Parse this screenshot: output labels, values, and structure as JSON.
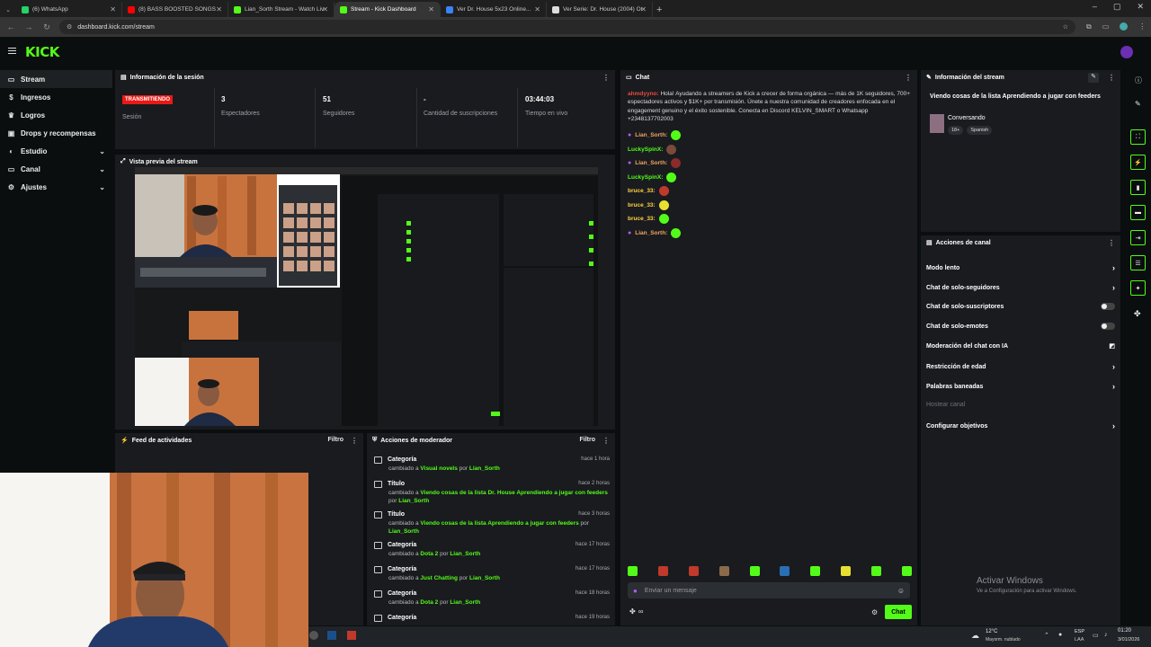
{
  "browser": {
    "tabs": [
      {
        "label": "(6) WhatsApp",
        "fav": "#25d366",
        "active": false
      },
      {
        "label": "(8) BASS BOOSTED SONGS 20...",
        "fav": "#ff0000",
        "active": false
      },
      {
        "label": "Lian_Sorth Stream - Watch Liv...",
        "fav": "#53fc18",
        "active": false
      },
      {
        "label": "Stream - Kick Dashboard",
        "fav": "#53fc18",
        "active": true
      },
      {
        "label": "Ver Dr. House 5x23 Online...",
        "fav": "#3b82f6",
        "active": false
      },
      {
        "label": "Ver Serie: Dr. House (2004) Onl...",
        "fav": "#dddddd",
        "active": false
      }
    ],
    "url": "dashboard.kick.com/stream"
  },
  "kick": {
    "logo": "KICK"
  },
  "sidebar": {
    "items": [
      {
        "label": "Stream",
        "icon": "broadcast-icon",
        "glyph": "▭",
        "active": true,
        "chev": false
      },
      {
        "label": "Ingresos",
        "icon": "money-icon",
        "glyph": "$",
        "active": false,
        "chev": false
      },
      {
        "label": "Logros",
        "icon": "trophy-icon",
        "glyph": "♛",
        "active": false,
        "chev": false
      },
      {
        "label": "Drops y recompensas",
        "icon": "gift-icon",
        "glyph": "▣",
        "active": false,
        "chev": false
      },
      {
        "label": "Estudio",
        "icon": "studio-icon",
        "glyph": "◐",
        "active": false,
        "chev": true
      },
      {
        "label": "Canal",
        "icon": "channel-icon",
        "glyph": "▭",
        "active": false,
        "chev": true
      },
      {
        "label": "Ajustes",
        "icon": "gear-icon",
        "glyph": "⚙",
        "active": false,
        "chev": true
      }
    ]
  },
  "session": {
    "title": "Información de la sesión",
    "badge": "TRANSMITIENDO",
    "session_label": "Sesión",
    "stats": [
      {
        "value": "3",
        "label": "Espectadores"
      },
      {
        "value": "51",
        "label": "Seguidores"
      },
      {
        "value": "-",
        "label": "Cantidad de suscripciones"
      },
      {
        "value": "03:44:03",
        "label": "Tiempo en vivo"
      }
    ]
  },
  "preview": {
    "title": "Vista previa del stream"
  },
  "activity": {
    "title": "Feed de actividades",
    "filter": "Filtro"
  },
  "moderator": {
    "title": "Acciones de moderador",
    "filter": "Filtro",
    "items": [
      {
        "type": "Categoría",
        "time": "hace 1 hora",
        "desc": "cambiado a",
        "value": "Visual novels",
        "by": "por",
        "user": "Lian_Sorth"
      },
      {
        "type": "Título",
        "time": "hace 2 horas",
        "desc": "cambiado a",
        "value": "Viendo cosas de la lista   Dr. House   Aprendiendo a jugar con feeders",
        "by": "por",
        "user": "Lian_Sorth"
      },
      {
        "type": "Título",
        "time": "hace 3 horas",
        "desc": "cambiado a",
        "value": "Viendo cosas de la lista   Aprendiendo a jugar con feeders",
        "by": "por",
        "user": "Lian_Sorth"
      },
      {
        "type": "Categoría",
        "time": "hace 17 horas",
        "desc": "cambiado a",
        "value": "Dota 2",
        "by": "por",
        "user": "Lian_Sorth"
      },
      {
        "type": "Categoría",
        "time": "hace 17 horas",
        "desc": "cambiado a",
        "value": "Just Chatting",
        "by": "por",
        "user": "Lian_Sorth"
      },
      {
        "type": "Categoría",
        "time": "hace 18 horas",
        "desc": "cambiado a",
        "value": "Dota 2",
        "by": "por",
        "user": "Lian_Sorth"
      },
      {
        "type": "Categoría",
        "time": "hace 19 horas",
        "desc": "",
        "value": "",
        "by": "",
        "user": ""
      }
    ]
  },
  "chat": {
    "title": "Chat",
    "promo_user": "ahmdyyno:",
    "promo_text": "Hola! Ayudando a streamers de Kick a crecer de forma orgánica — más de 1K seguidores, 700+ espectadores activos y $1K+ por transmisión. Únete a nuestra comunidad de creadores enfocada en el engagement genuino y el éxito sostenible. Conecta en Discord KELVIN_SMART o Whatsapp +2348137702003",
    "lines": [
      {
        "user": "Lian_Sorth:",
        "color": "#f4a460",
        "badge": true,
        "emote": "#53fc18"
      },
      {
        "user": "LuckySpinX:",
        "color": "#53fc18",
        "badge": false,
        "emote": "#7a4a3a"
      },
      {
        "user": "Lian_Sorth:",
        "color": "#f4a460",
        "badge": true,
        "emote": "#8b2b2b"
      },
      {
        "user": "LuckySpinX:",
        "color": "#53fc18",
        "badge": false,
        "emote": "#53fc18"
      },
      {
        "user": "bruce_33:",
        "color": "#ffd23f",
        "badge": false,
        "emote": "#c0392b"
      },
      {
        "user": "bruce_33:",
        "color": "#ffd23f",
        "badge": false,
        "emote": "#e8e030"
      },
      {
        "user": "bruce_33:",
        "color": "#ffd23f",
        "badge": false,
        "emote": "#53fc18"
      },
      {
        "user": "Lian_Sorth:",
        "color": "#f4a460",
        "badge": true,
        "emote": "#53fc18"
      }
    ],
    "emote_bar": [
      "#53fc18",
      "#c0392b",
      "#c0392b",
      "#8a6a4a",
      "#53fc18",
      "#2a6fb3",
      "#53fc18",
      "#e8e030",
      "#53fc18",
      "#53fc18"
    ],
    "placeholder": "Enviar un mensaje",
    "send": "Chat",
    "points": "∞"
  },
  "stream_info": {
    "title": "Información del stream",
    "stream_title": "Viendo cosas de la lista   Aprendiendo a jugar con feeders",
    "category": "Conversando",
    "tags": [
      "18+",
      "Spanish"
    ]
  },
  "channel_actions": {
    "title": "Acciones de canal",
    "items": [
      {
        "label": "Modo lento",
        "kind": "chevron",
        "muted": false
      },
      {
        "label": "Chat de solo-seguidores",
        "kind": "chevron",
        "muted": false
      },
      {
        "label": "Chat de solo-suscriptores",
        "kind": "toggle",
        "muted": false
      },
      {
        "label": "Chat de solo-emotes",
        "kind": "toggle",
        "muted": false
      },
      {
        "label": "Moderación del chat con IA",
        "kind": "icon",
        "muted": false
      },
      {
        "label": "Restricción de edad",
        "kind": "chevron",
        "muted": false
      },
      {
        "label": "Palabras baneadas",
        "kind": "chevron",
        "muted": false
      },
      {
        "label": "Hostear canal",
        "kind": "none",
        "muted": true
      },
      {
        "label": "Configurar objetivos",
        "kind": "chevron",
        "muted": false
      }
    ]
  },
  "windows": {
    "activate_title": "Activar Windows",
    "activate_sub": "Ve a Configuración para activar Windows."
  },
  "taskbar": {
    "weather": "12°C",
    "weather_sub": "Mayorm. nublado",
    "lang": "ESP",
    "lang_sub": "LAA",
    "time": "01:20",
    "date": "3/01/2026"
  }
}
